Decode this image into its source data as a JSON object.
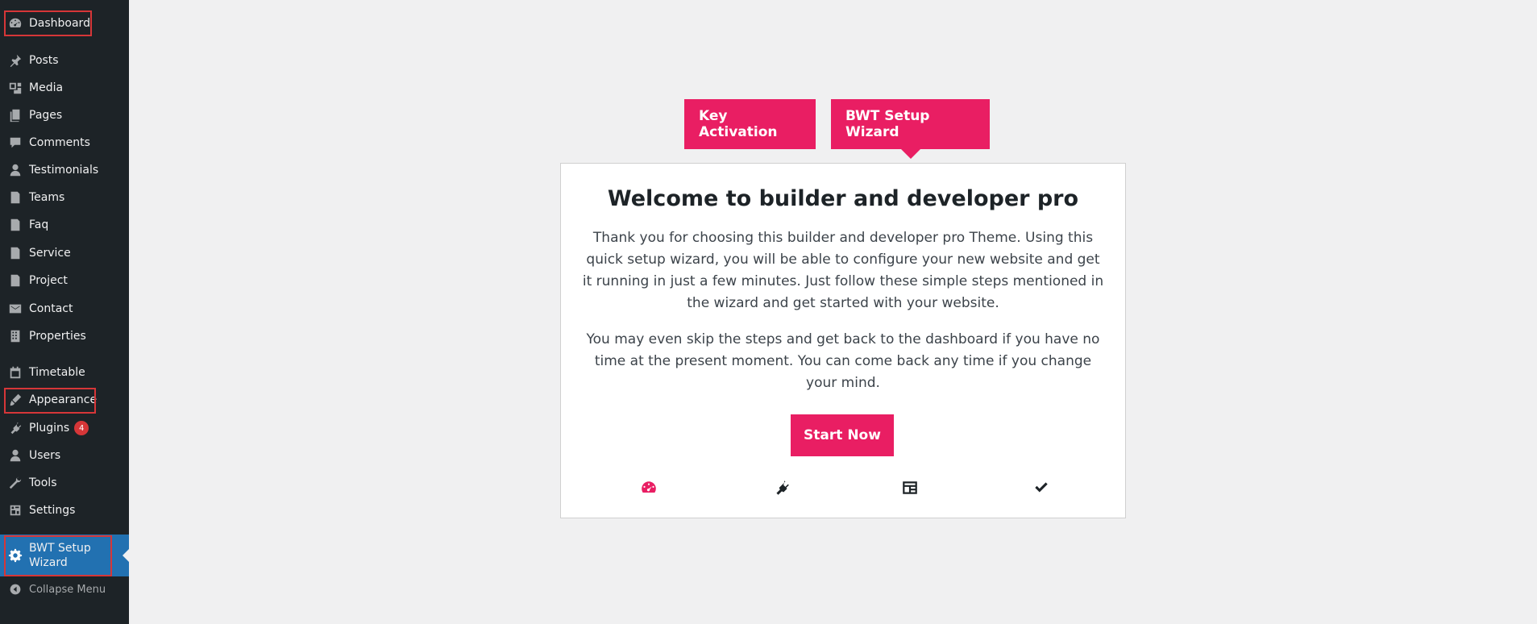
{
  "sidebar": {
    "items": [
      {
        "label": "Dashboard",
        "icon": "dashboard-icon"
      },
      {
        "label": "Posts",
        "icon": "pin-icon"
      },
      {
        "label": "Media",
        "icon": "media-icon"
      },
      {
        "label": "Pages",
        "icon": "pages-icon"
      },
      {
        "label": "Comments",
        "icon": "comment-icon"
      },
      {
        "label": "Testimonials",
        "icon": "user-icon"
      },
      {
        "label": "Teams",
        "icon": "document-icon"
      },
      {
        "label": "Faq",
        "icon": "document-icon"
      },
      {
        "label": "Service",
        "icon": "document-icon"
      },
      {
        "label": "Project",
        "icon": "document-icon"
      },
      {
        "label": "Contact",
        "icon": "mail-icon"
      },
      {
        "label": "Properties",
        "icon": "building-icon"
      },
      {
        "label": "Timetable",
        "icon": "calendar-icon"
      },
      {
        "label": "Appearance",
        "icon": "brush-icon"
      },
      {
        "label": "Plugins",
        "icon": "plugin-icon",
        "badge": "4"
      },
      {
        "label": "Users",
        "icon": "users-icon"
      },
      {
        "label": "Tools",
        "icon": "wrench-icon"
      },
      {
        "label": "Settings",
        "icon": "settings-icon"
      },
      {
        "label": "BWT Setup Wizard",
        "icon": "gear-icon"
      }
    ],
    "collapse_label": "Collapse Menu"
  },
  "tabs": [
    {
      "label": "Key Activation"
    },
    {
      "label": "BWT Setup Wizard"
    }
  ],
  "card": {
    "title": "Welcome to builder and developer pro",
    "paragraph1": "Thank you for choosing this builder and developer pro Theme. Using this quick setup wizard, you will be able to configure your new website and get it running in just a few minutes. Just follow these simple steps mentioned in the wizard and get started with your website.",
    "paragraph2": "You may even skip the steps and get back to the dashboard if you have no time at the present moment. You can come back any time if you change your mind.",
    "button_label": "Start Now"
  },
  "steps": [
    "dashboard-icon",
    "plugin-icon",
    "layout-icon",
    "check-icon"
  ],
  "colors": {
    "sidebar_bg": "#1d2327",
    "active_bg": "#2271b1",
    "accent": "#e91e63",
    "highlight": "#d63638"
  }
}
